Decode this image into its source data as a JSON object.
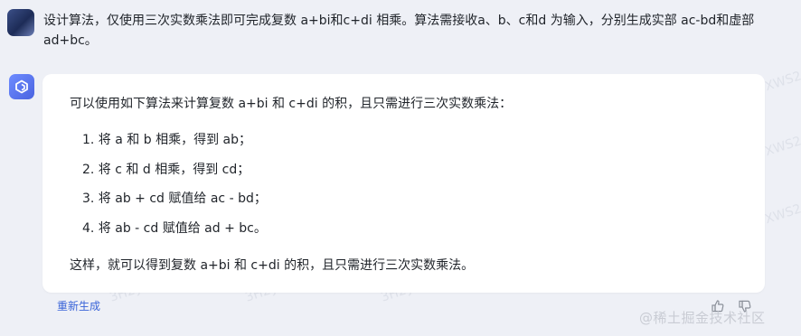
{
  "user_message": {
    "text": "设计算法，仅使用三次实数乘法即可完成复数 a+bi和c+di 相乘。算法需接收a、b、c和d 为输入，分别生成实部 ac-bd和虚部ad+bc。"
  },
  "assistant": {
    "intro": "可以使用如下算法来计算复数 a+bi 和 c+di 的积，且只需进行三次实数乘法：",
    "steps": [
      "1. 将 a 和 b 相乘，得到 ab；",
      "2. 将 c 和 d 相乘，得到 cd；",
      "3. 将 ab + cd 赋值给 ac - bd；",
      "4. 将 ab - cd 赋值给 ad + bc。"
    ],
    "outro": "这样，就可以得到复数 a+bi 和 c+di 的积，且只需进行三次实数乘法。"
  },
  "actions": {
    "regenerate_label": "重新生成"
  },
  "watermark": {
    "text": "3H2yXWS2"
  },
  "footer": {
    "brand": "@稀土掘金技术社区"
  },
  "colors": {
    "background": "#eef0f6",
    "card": "#ffffff",
    "accent": "#3a64d8",
    "bot_avatar": "#5a74ee"
  },
  "icons": {
    "user_avatar": "user-avatar",
    "bot_avatar": "cube-logo-icon",
    "like": "thumbs-up-icon",
    "dislike": "thumbs-down-icon"
  }
}
